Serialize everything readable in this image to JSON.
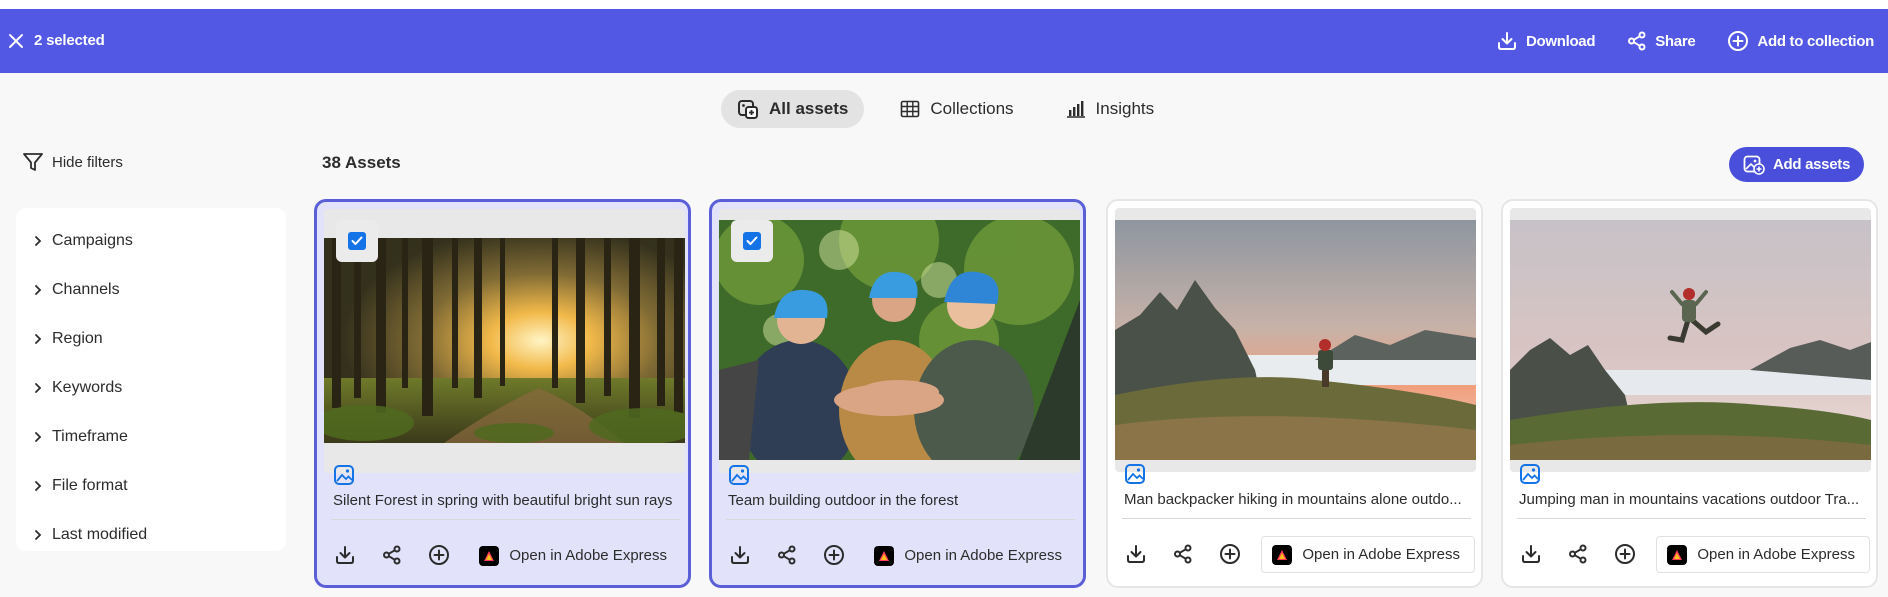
{
  "selection_bar": {
    "count_label": "2 selected",
    "download_label": "Download",
    "share_label": "Share",
    "add_to_collection_label": "Add to collection",
    "background": "#5258e4"
  },
  "tabs": [
    {
      "label": "All assets",
      "icon": "all-assets-icon",
      "active": true
    },
    {
      "label": "Collections",
      "icon": "grid-icon",
      "active": false
    },
    {
      "label": "Insights",
      "icon": "bar-chart-icon",
      "active": false
    }
  ],
  "toolbar": {
    "hide_filters_label": "Hide filters",
    "asset_count_label": "38 Assets",
    "add_assets_label": "Add assets"
  },
  "filters": [
    {
      "label": "Campaigns"
    },
    {
      "label": "Channels"
    },
    {
      "label": "Region"
    },
    {
      "label": "Keywords"
    },
    {
      "label": "Timeframe"
    },
    {
      "label": "File format"
    },
    {
      "label": "Last modified"
    }
  ],
  "assets": [
    {
      "title": "Silent Forest in spring with beautiful bright sun rays",
      "selected": true,
      "open_label": "Open in Adobe Express",
      "image": "forest-with-sun-rays"
    },
    {
      "title": "Team building outdoor in the forest",
      "selected": true,
      "open_label": "Open in Adobe Express",
      "image": "team-hands-together"
    },
    {
      "title": "Man backpacker hiking in mountains alone outdo...",
      "selected": false,
      "open_label": "Open in Adobe Express",
      "image": "hiker-in-mountains"
    },
    {
      "title": "Jumping man in mountains vacations outdoor Tra...",
      "selected": false,
      "open_label": "Open in Adobe Express",
      "image": "jumping-man-mountains"
    }
  ],
  "colors": {
    "accent": "#5258e4",
    "add_assets_button": "#4a4fdb",
    "selected_card_bg": "#e2e3fb",
    "checkbox": "#1473e6"
  }
}
